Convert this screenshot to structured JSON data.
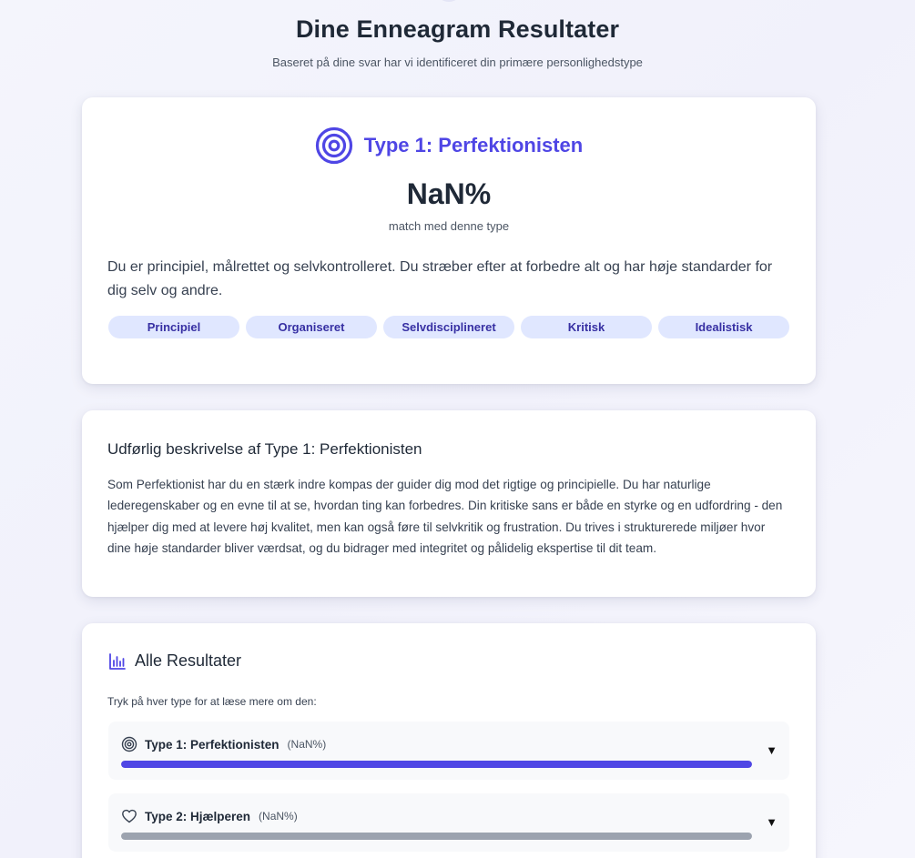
{
  "header": {
    "title": "Dine Enneagram Resultater",
    "subtitle": "Baseret på dine svar har vi identificeret din primære personlighedstype"
  },
  "primary": {
    "icon": "target-icon",
    "type_title": "Type 1: Perfektionisten",
    "score": "NaN%",
    "score_caption": "match med denne type",
    "summary": "Du er principiel, målrettet og selvkontrolleret. Du stræber efter at forbedre alt og har høje standarder for dig selv og andre.",
    "traits": [
      "Principiel",
      "Organiseret",
      "Selvdisciplineret",
      "Kritisk",
      "Idealistisk"
    ]
  },
  "description": {
    "title": "Udførlig beskrivelse af Type 1: Perfektionisten",
    "body": "Som Perfektionist har du en stærk indre kompas der guider dig mod det rigtige og principielle. Du har naturlige lederegenskaber og en evne til at se, hvordan ting kan forbedres. Din kritiske sans er både en styrke og en udfordring - den hjælper dig med at levere høj kvalitet, men kan også føre til selvkritik og frustration. Du trives i strukturerede miljøer hvor dine høje standarder bliver værdsat, og du bidrager med integritet og pålidelig ekspertise til dit team."
  },
  "all_results": {
    "icon": "bar-chart-icon",
    "title": "Alle Resultater",
    "hint": "Tryk på hver type for at læse mere om den:",
    "items": [
      {
        "icon": "target-icon",
        "name": "Type 1: Perfektionisten",
        "pct": "(NaN%)",
        "fill": 1.0,
        "expand_glyph": "▼"
      },
      {
        "icon": "heart-icon",
        "name": "Type 2: Hjælperen",
        "pct": "(NaN%)",
        "fill": 1.0,
        "expand_glyph": "▼"
      }
    ]
  },
  "colors": {
    "accent": "#4f46e5",
    "trait_bg": "#e0e7ff",
    "trait_text": "#3730a3",
    "muted_bar": "#9ca3af"
  }
}
